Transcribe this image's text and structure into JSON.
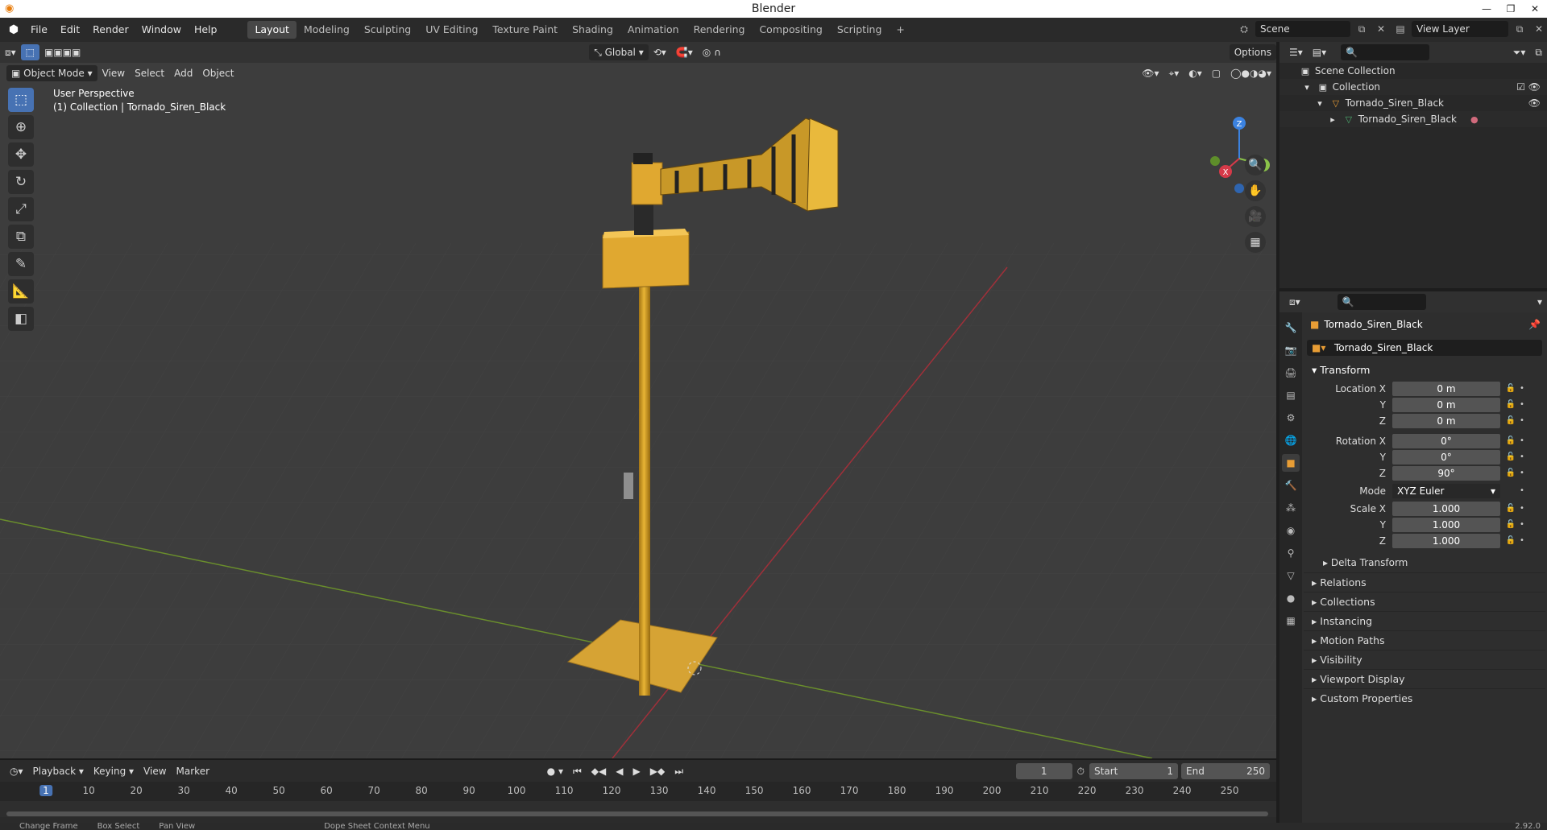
{
  "window": {
    "title": "Blender"
  },
  "menu": [
    "File",
    "Edit",
    "Render",
    "Window",
    "Help"
  ],
  "workspaces": [
    "Layout",
    "Modeling",
    "Sculpting",
    "UV Editing",
    "Texture Paint",
    "Shading",
    "Animation",
    "Rendering",
    "Compositing",
    "Scripting"
  ],
  "scene": {
    "name": "Scene",
    "view_layer": "View Layer"
  },
  "viewport": {
    "mode": "Object Mode",
    "menus": [
      "View",
      "Select",
      "Add",
      "Object"
    ],
    "orientation": "Global",
    "options": "Options",
    "info_line1": "User Perspective",
    "info_line2": "(1) Collection | Tornado_Siren_Black",
    "gizmo_axes": {
      "x": "X",
      "y": "Y",
      "z": "Z"
    }
  },
  "outliner": {
    "rows": [
      {
        "label": "Scene Collection",
        "icon": "scene-collection-icon"
      },
      {
        "label": "Collection",
        "icon": "collection-icon"
      },
      {
        "label": "Tornado_Siren_Black",
        "icon": "object-icon"
      },
      {
        "label": "Tornado_Siren_Black",
        "icon": "mesh-data-icon"
      }
    ]
  },
  "properties": {
    "object_name": "Tornado_Siren_Black",
    "object_field": "Tornado_Siren_Black",
    "transform_title": "Transform",
    "location": {
      "label": "Location X",
      "x": "0 m",
      "y": "0 m",
      "z": "0 m"
    },
    "rotation": {
      "label": "Rotation X",
      "x": "0°",
      "y": "0°",
      "z": "90°"
    },
    "mode": {
      "label": "Mode",
      "value": "XYZ Euler"
    },
    "scale": {
      "label": "Scale X",
      "x": "1.000",
      "y": "1.000",
      "z": "1.000"
    },
    "axis_labels": {
      "y": "Y",
      "z": "Z"
    },
    "delta_transform": "Delta Transform",
    "panels": [
      "Relations",
      "Collections",
      "Instancing",
      "Motion Paths",
      "Visibility",
      "Viewport Display",
      "Custom Properties"
    ]
  },
  "timeline": {
    "menus": [
      "Playback",
      "Keying",
      "View",
      "Marker"
    ],
    "current_frame": "1",
    "start_label": "Start",
    "start": "1",
    "end_label": "End",
    "end": "250",
    "ticks": [
      "1",
      "10",
      "20",
      "30",
      "40",
      "50",
      "60",
      "70",
      "80",
      "90",
      "100",
      "110",
      "120",
      "130",
      "140",
      "150",
      "160",
      "170",
      "180",
      "190",
      "200",
      "210",
      "220",
      "230",
      "240",
      "250"
    ]
  },
  "statusbar": {
    "items": [
      "Change Frame",
      "Box Select",
      "Pan View",
      "Dope Sheet Context Menu"
    ],
    "version": "2.92.0"
  },
  "colors": {
    "accent": "#4772b3",
    "object_yellow": "#e0a830",
    "x_axis": "#d63a49",
    "y_axis": "#8bc34a",
    "z_axis": "#3b82e0"
  }
}
